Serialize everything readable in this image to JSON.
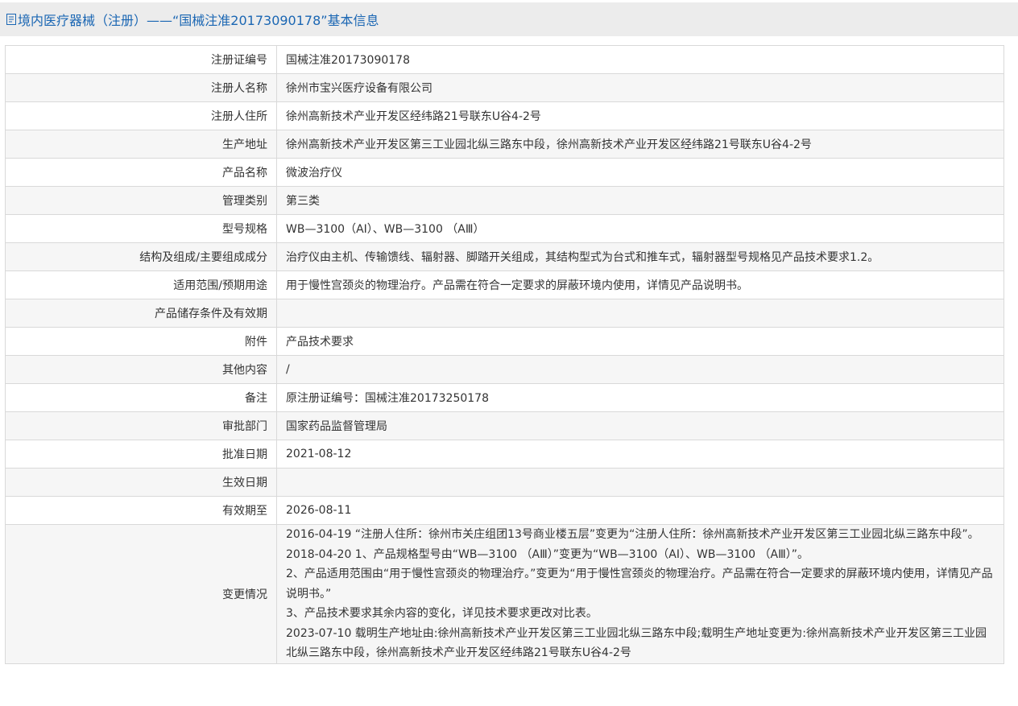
{
  "header": {
    "icon": "document-icon",
    "title": "境内医疗器械（注册）——“国械注准20173090178”基本信息"
  },
  "rows": [
    {
      "label": "注册证编号",
      "value": "国械注准20173090178"
    },
    {
      "label": "注册人名称",
      "value": "徐州市宝兴医疗设备有限公司"
    },
    {
      "label": "注册人住所",
      "value": "徐州高新技术产业开发区经纬路21号联东U谷4-2号"
    },
    {
      "label": "生产地址",
      "value": "徐州高新技术产业开发区第三工业园北纵三路东中段，徐州高新技术产业开发区经纬路21号联东U谷4-2号"
    },
    {
      "label": "产品名称",
      "value": "微波治疗仪"
    },
    {
      "label": "管理类别",
      "value": "第三类"
    },
    {
      "label": "型号规格",
      "value": "WB—3100（AⅠ）、WB—3100 （AⅢ）"
    },
    {
      "label": "结构及组成/主要组成成分",
      "value": "治疗仪由主机、传输馈线、辐射器、脚踏开关组成，其结构型式为台式和推车式，辐射器型号规格见产品技术要求1.2。"
    },
    {
      "label": "适用范围/预期用途",
      "value": "用于慢性宫颈炎的物理治疗。产品需在符合一定要求的屏蔽环境内使用，详情见产品说明书。"
    },
    {
      "label": "产品储存条件及有效期",
      "value": ""
    },
    {
      "label": "附件",
      "value": "产品技术要求"
    },
    {
      "label": "其他内容",
      "value": "/"
    },
    {
      "label": "备注",
      "value": "原注册证编号：国械注准20173250178"
    },
    {
      "label": "审批部门",
      "value": "国家药品监督管理局"
    },
    {
      "label": "批准日期",
      "value": "2021-08-12"
    },
    {
      "label": "生效日期",
      "value": ""
    },
    {
      "label": "有效期至",
      "value": "2026-08-11"
    }
  ],
  "changes": {
    "label": "变更情况",
    "lines": [
      "2016-04-19 “注册人住所：徐州市关庄组团13号商业楼五层”变更为“注册人住所：徐州高新技术产业开发区第三工业园北纵三路东中段”。",
      "2018-04-20 1、产品规格型号由“WB—3100 （AⅢ）”变更为“WB—3100（AⅠ）、WB—3100 （AⅢ）”。",
      "2、产品适用范围由“用于慢性宫颈炎的物理治疗。”变更为“用于慢性宫颈炎的物理治疗。产品需在符合一定要求的屏蔽环境内使用，详情见产品说明书。”",
      "3、产品技术要求其余内容的变化，详见技术要求更改对比表。",
      "2023-07-10 载明生产地址由:徐州高新技术产业开发区第三工业园北纵三路东中段;载明生产地址变更为:徐州高新技术产业开发区第三工业园北纵三路东中段，徐州高新技术产业开发区经纬路21号联东U谷4-2号"
    ]
  },
  "colors": {
    "title": "#1a66b3",
    "header_bg": "#ececec",
    "row_alt_bg": "#f6f6f6",
    "border": "#d9d9d9",
    "text": "#333333"
  }
}
